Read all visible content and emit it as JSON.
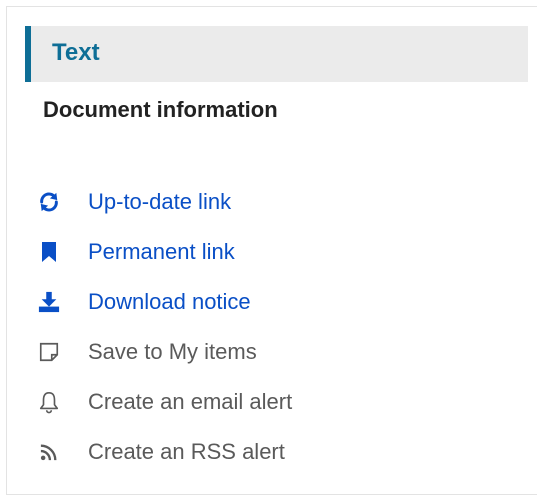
{
  "section": {
    "title": "Text"
  },
  "document_info": {
    "heading": "Document information"
  },
  "actions": [
    {
      "label": "Up-to-date link",
      "icon": "refresh-icon"
    },
    {
      "label": "Permanent link",
      "icon": "bookmark-icon"
    },
    {
      "label": "Download notice",
      "icon": "download-icon"
    },
    {
      "label": "Save to My items",
      "icon": "note-icon"
    },
    {
      "label": "Create an email alert",
      "icon": "bell-icon"
    },
    {
      "label": "Create an RSS alert",
      "icon": "rss-icon"
    }
  ],
  "colors": {
    "accent": "#0e6e96",
    "link": "#0a4fc6",
    "muted": "#5a5a5a",
    "header_bg": "#ebebeb"
  }
}
